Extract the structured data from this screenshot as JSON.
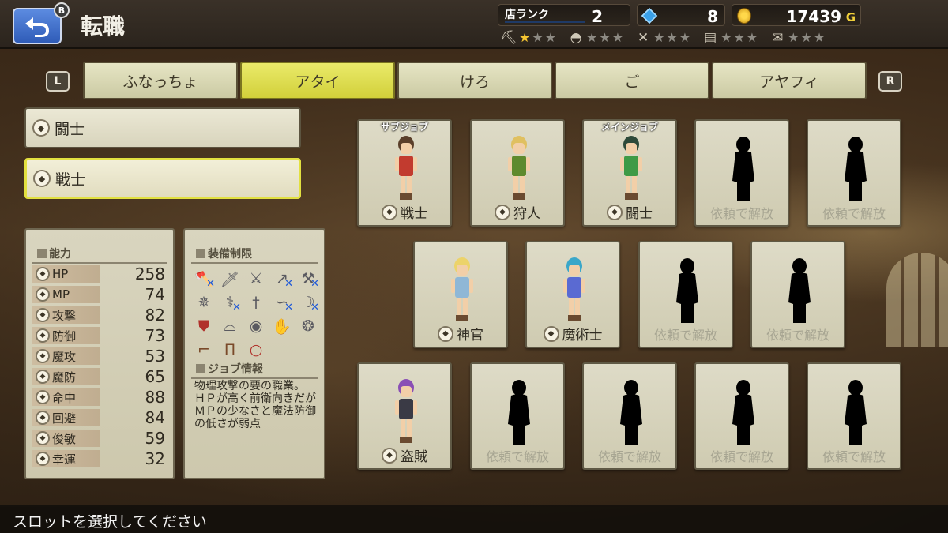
{
  "header": {
    "title": "転職",
    "back_badge": "B",
    "rank_label": "店ランク",
    "rank_value": "2",
    "gems": "8",
    "gold": "17439",
    "gold_unit": "G",
    "ratings": [
      {
        "icon": "pickaxe-icon",
        "stars": 1
      },
      {
        "icon": "helmet-icon",
        "stars": 0
      },
      {
        "icon": "crossed-tools-icon",
        "stars": 0
      },
      {
        "icon": "shelf-icon",
        "stars": 0
      },
      {
        "icon": "scroll-icon",
        "stars": 0
      }
    ]
  },
  "tabs": {
    "left_button": "L",
    "right_button": "R",
    "items": [
      {
        "label": "ふなっちょ"
      },
      {
        "label": "アタイ",
        "active": true
      },
      {
        "label": "けろ"
      },
      {
        "label": "ご"
      },
      {
        "label": "アヤフィ"
      }
    ]
  },
  "job_list": [
    {
      "label": "闘士"
    },
    {
      "label": "戦士",
      "active": true
    }
  ],
  "ability": {
    "title": "能力",
    "stats": [
      {
        "label": "HP",
        "value": "258"
      },
      {
        "label": "MP",
        "value": "74"
      },
      {
        "label": "攻撃",
        "value": "82"
      },
      {
        "label": "防御",
        "value": "73"
      },
      {
        "label": "魔攻",
        "value": "53"
      },
      {
        "label": "魔防",
        "value": "65"
      },
      {
        "label": "命中",
        "value": "88"
      },
      {
        "label": "回避",
        "value": "84"
      },
      {
        "label": "俊敏",
        "value": "59"
      },
      {
        "label": "幸運",
        "value": "32"
      }
    ]
  },
  "equipment": {
    "title": "装備制限",
    "job_info_title": "ジョブ情報",
    "job_info_text": "物理攻撃の要の職業。\nＨＰが高く前衛向きだがＭＰの少なさと魔法防御の低さが弱点",
    "items": [
      {
        "icon": "axe-icon",
        "restricted": true
      },
      {
        "icon": "sword-icon",
        "restricted": false
      },
      {
        "icon": "greatsword-icon",
        "restricted": false
      },
      {
        "icon": "spear-icon",
        "restricted": true
      },
      {
        "icon": "hammer-icon",
        "restricted": true
      },
      {
        "icon": "mace-icon",
        "restricted": false
      },
      {
        "icon": "staff-icon",
        "restricted": true
      },
      {
        "icon": "dagger-icon",
        "restricted": false
      },
      {
        "icon": "whip-icon",
        "restricted": true
      },
      {
        "icon": "bow-icon",
        "restricted": true
      },
      {
        "icon": "shield-icon",
        "restricted": false
      },
      {
        "icon": "hat-icon",
        "restricted": false
      },
      {
        "icon": "armor-icon",
        "restricted": false
      },
      {
        "icon": "gauntlet-icon",
        "restricted": false
      },
      {
        "icon": "accessory-icon",
        "restricted": false
      },
      {
        "icon": "boots-icon",
        "restricted": false
      },
      {
        "icon": "legs-icon",
        "restricted": false
      },
      {
        "icon": "ring-icon",
        "restricted": false
      }
    ]
  },
  "slots": [
    {
      "tag": "サブジョブ",
      "label": "戦士",
      "hair": "#5a3f2a",
      "cloth": "#c23b2f",
      "unlocked": true
    },
    {
      "tag": "",
      "label": "狩人",
      "hair": "#e0c060",
      "cloth": "#5e8a2e",
      "unlocked": true
    },
    {
      "tag": "メインジョブ",
      "label": "闘士",
      "hair": "#2e4a3a",
      "cloth": "#3f9a46",
      "unlocked": true
    },
    {
      "tag": "",
      "label": "依頼で解放",
      "unlocked": false
    },
    {
      "tag": "",
      "label": "依頼で解放",
      "unlocked": false
    },
    {
      "tag": "",
      "label": "神官",
      "hair": "#ecd36a",
      "cloth": "#8fb7d6",
      "unlocked": true
    },
    {
      "tag": "",
      "label": "魔術士",
      "hair": "#3aa7c9",
      "cloth": "#5a6ad2",
      "unlocked": true
    },
    {
      "tag": "",
      "label": "依頼で解放",
      "unlocked": false
    },
    {
      "tag": "",
      "label": "依頼で解放",
      "unlocked": false
    },
    {
      "tag": "",
      "label": "盗賊",
      "hair": "#8a4fb5",
      "cloth": "#3a3a45",
      "unlocked": true
    },
    {
      "tag": "",
      "label": "依頼で解放",
      "unlocked": false
    },
    {
      "tag": "",
      "label": "依頼で解放",
      "unlocked": false
    },
    {
      "tag": "",
      "label": "依頼で解放",
      "unlocked": false
    },
    {
      "tag": "",
      "label": "依頼で解放",
      "unlocked": false
    }
  ],
  "footer": {
    "message": "スロットを選択してください"
  }
}
